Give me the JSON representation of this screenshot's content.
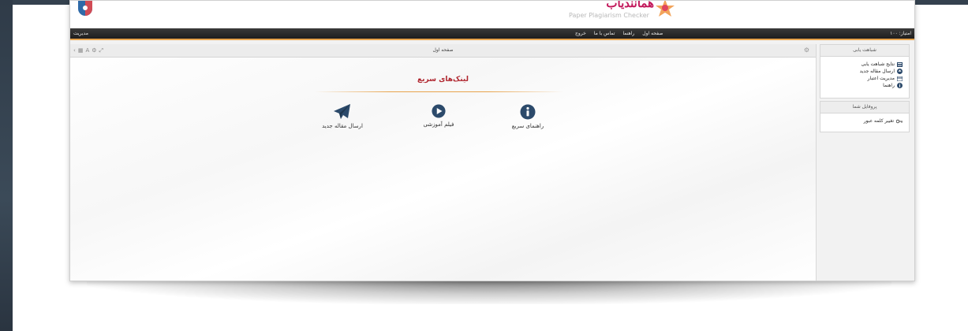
{
  "header": {
    "brand_title": "همانندیاب",
    "brand_subtitle": "Paper Plagiarism Checker"
  },
  "navbar": {
    "user": "مدیریت",
    "menu": [
      "صفحه اول",
      "راهنما",
      "تماس با ما",
      "خروج"
    ],
    "right_text": "امتیاز: ۱۰۰"
  },
  "panel": {
    "title": "صفحه اول"
  },
  "quick_links": {
    "title": "لینک‌های سریع",
    "items": [
      {
        "label": "راهنمای سریع",
        "icon": "info-circle-icon"
      },
      {
        "label": "فیلم آموزشی",
        "icon": "play-circle-icon"
      },
      {
        "label": "ارسال مقاله جدید",
        "icon": "paper-plane-icon"
      }
    ]
  },
  "sidebar": {
    "box1": {
      "title": "شباهت یابی",
      "items": [
        {
          "label": "نتایج شباهت یابی",
          "icon": "list-icon"
        },
        {
          "label": "ارسال مقاله جدید",
          "icon": "upload-icon"
        },
        {
          "label": "مدیریت اعتبار",
          "icon": "credit-card-icon"
        },
        {
          "label": "راهنما",
          "icon": "help-icon"
        }
      ]
    },
    "box2": {
      "title": "پروفایل شما",
      "items": [
        {
          "label": "تغییر کلمه عبور",
          "icon": "key-icon"
        }
      ]
    }
  },
  "colors": {
    "accent": "#e8a44d",
    "brand": "#c2185b",
    "quicklink_icon": "#2c4a6b",
    "title_red": "#b0262f"
  }
}
